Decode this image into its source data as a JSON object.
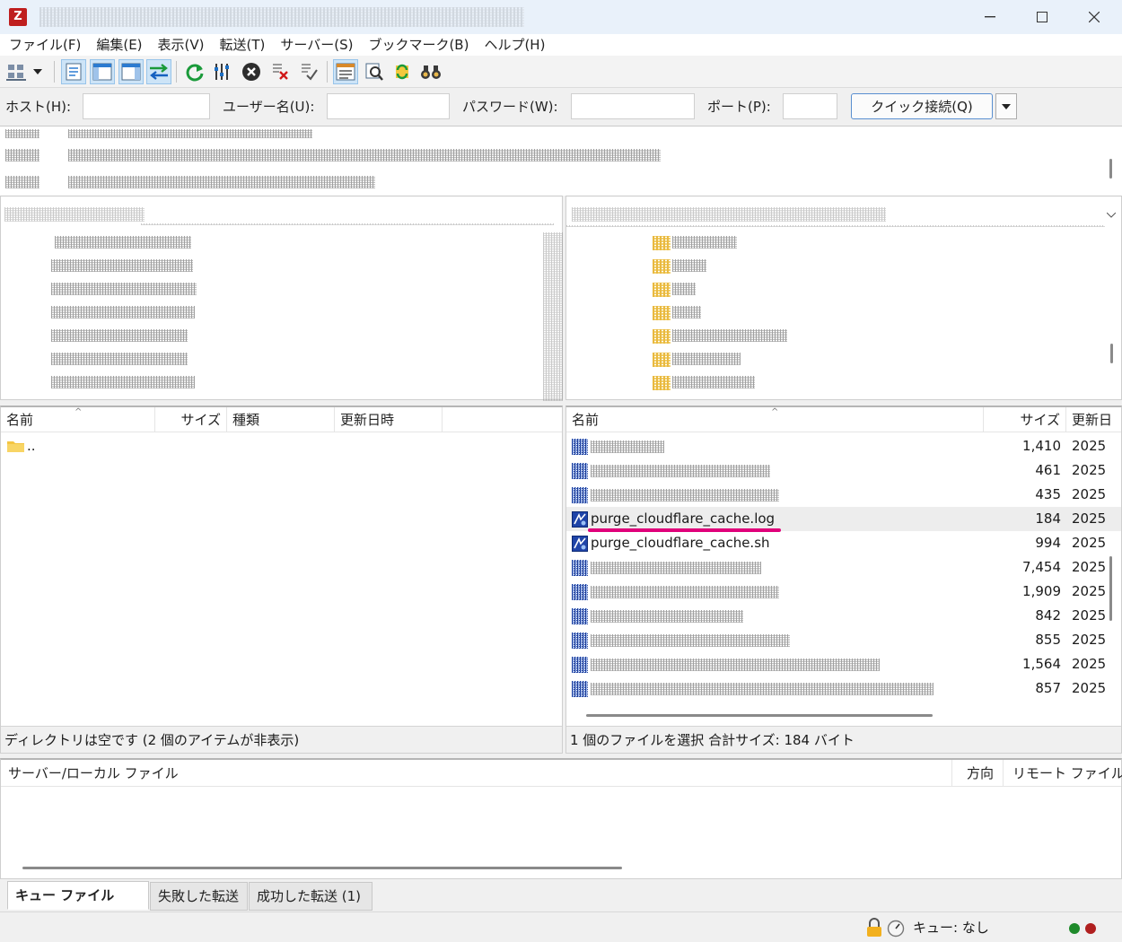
{
  "menu": {
    "items": [
      "ファイル(F)",
      "編集(E)",
      "表示(V)",
      "転送(T)",
      "サーバー(S)",
      "ブックマーク(B)",
      "ヘルプ(H)"
    ]
  },
  "quickconnect": {
    "host_label": "ホスト(H):",
    "user_label": "ユーザー名(U):",
    "password_label": "パスワード(W):",
    "port_label": "ポート(P):",
    "host_value": "",
    "user_value": "",
    "password_value": "",
    "port_value": "",
    "connect_button": "クイック接続(Q)"
  },
  "local_list": {
    "headers": {
      "name": "名前",
      "size": "サイズ",
      "type": "種類",
      "modified": "更新日時"
    },
    "parent_entry": "..",
    "status": "ディレクトリは空です (2 個のアイテムが非表示)"
  },
  "remote_list": {
    "headers": {
      "name": "名前",
      "size": "サイズ",
      "modified": "更新日"
    },
    "rows": [
      {
        "name": "",
        "size": "1,410",
        "date": "2025"
      },
      {
        "name": "",
        "size": "461",
        "date": "2025"
      },
      {
        "name": "",
        "size": "435",
        "date": "2025"
      },
      {
        "name": "purge_cloudflare_cache.log",
        "size": "184",
        "date": "2025"
      },
      {
        "name": "purge_cloudflare_cache.sh",
        "size": "994",
        "date": "2025"
      },
      {
        "name": "",
        "size": "7,454",
        "date": "2025"
      },
      {
        "name": "",
        "size": "1,909",
        "date": "2025"
      },
      {
        "name": "",
        "size": "842",
        "date": "2025"
      },
      {
        "name": "",
        "size": "855",
        "date": "2025"
      },
      {
        "name": "",
        "size": "1,564",
        "date": "2025"
      },
      {
        "name": "",
        "size": "857",
        "date": "2025"
      }
    ],
    "selected_index": 3,
    "status": "1 個のファイルを選択 合計サイズ: 184 バイト"
  },
  "queue": {
    "headers": {
      "file": "サーバー/ローカル ファイル",
      "direction": "方向",
      "remote": "リモート ファイル"
    }
  },
  "tabs": [
    "キュー ファイル",
    "失敗した転送",
    "成功した転送 (1)"
  ],
  "statusbar": {
    "queue": "キュー: なし"
  },
  "colors": {
    "highlight_underline": "#e0007a",
    "title_bar": "#e9f1fa",
    "accent": "#0078d4"
  }
}
